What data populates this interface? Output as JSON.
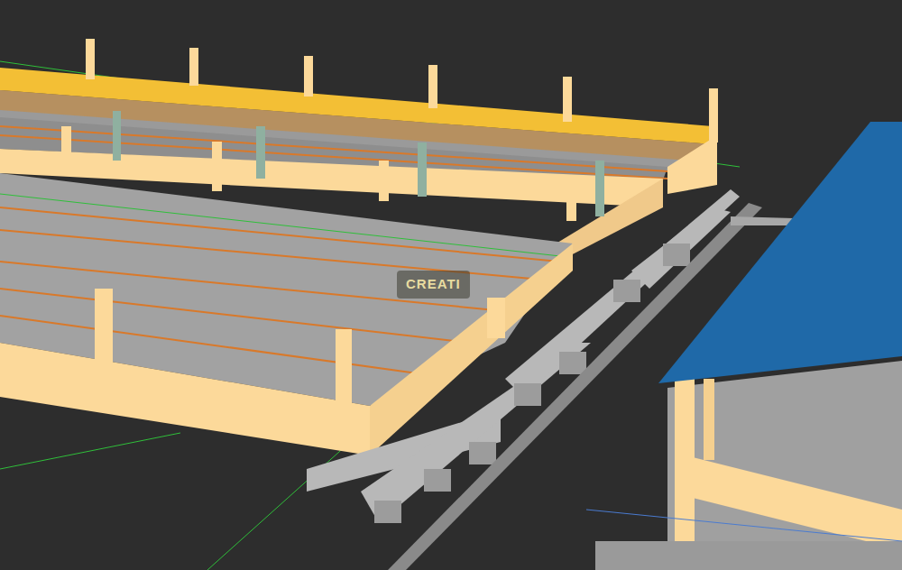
{
  "watermark": {
    "text": "CREATI"
  }
}
